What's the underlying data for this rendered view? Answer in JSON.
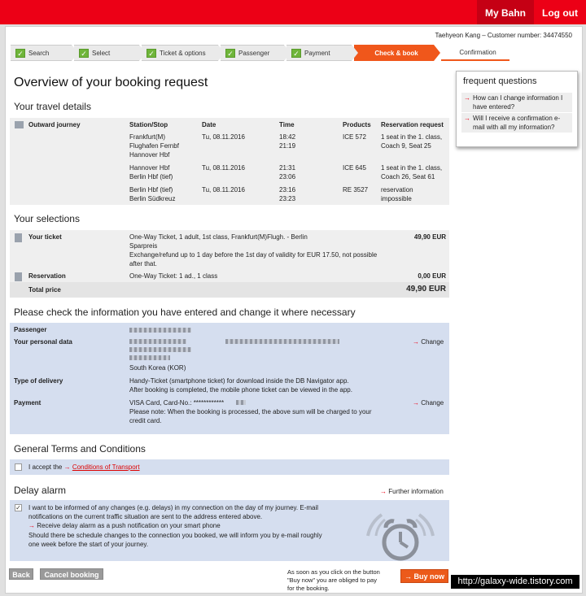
{
  "topnav": {
    "mybahn": "My Bahn",
    "logout": "Log out"
  },
  "customer": "Taehyeon Kang – Customer number: 34474550",
  "steps": [
    {
      "label": "Search"
    },
    {
      "label": "Select"
    },
    {
      "label": "Ticket & options"
    },
    {
      "label": "Passenger"
    },
    {
      "label": "Payment"
    },
    {
      "label": "Check & book"
    },
    {
      "label": "Confirmation"
    }
  ],
  "title": "Overview of your booking request",
  "travel": {
    "heading": "Your travel details",
    "headers": {
      "station": "Station/Stop",
      "date": "Date",
      "time": "Time",
      "products": "Products",
      "reservation": "Reservation request"
    },
    "journey_label": "Outward journey",
    "legs": [
      {
        "station1": "Frankfurt(M)",
        "station2": "Flughafen Fernbf",
        "station3": "Hannover Hbf",
        "date": "Tu, 08.11.2016",
        "time1": "18:42",
        "time2": "21:19",
        "product": "ICE 572",
        "res1": "1 seat in the 1. class,",
        "res2": "Coach 9, Seat 25"
      },
      {
        "station1": "Hannover Hbf",
        "station2": "Berlin Hbf (tief)",
        "date": "Tu, 08.11.2016",
        "time1": "21:31",
        "time2": "23:06",
        "product": "ICE 645",
        "res1": "1 seat in the 1. class,",
        "res2": "Coach 26, Seat 61"
      },
      {
        "station1": "Berlin Hbf (tief)",
        "station2": "Berlin Südkreuz",
        "date": "Tu, 08.11.2016",
        "time1": "23:16",
        "time2": "23:23",
        "product": "RE 3527",
        "res1": "reservation",
        "res2": "impossible"
      }
    ]
  },
  "selections": {
    "heading": "Your selections",
    "ticket_label": "Your ticket",
    "ticket_l1": "One-Way Ticket, 1 adult, 1st class, Frankfurt(M)Flugh. - Berlin",
    "ticket_l2": "Sparpreis",
    "ticket_l3": "Exchange/refund up to 1 day before the 1st day of validity for EUR 17.50, not possible",
    "ticket_l4": "after that.",
    "ticket_price": "49,90 EUR",
    "reservation_label": "Reservation",
    "reservation_desc": "One-Way Ticket: 1 ad., 1 class",
    "reservation_price": "0,00 EUR",
    "total_label": "Total price",
    "total_price": "49,90 EUR"
  },
  "check": {
    "heading": "Please check the information you have entered and change it where necessary",
    "passenger_label": "Passenger",
    "personal_label": "Your personal data",
    "country": "South Korea (KOR)",
    "change": "Change",
    "delivery_label": "Type of delivery",
    "delivery_l1": "Handy-Ticket (smartphone ticket) for download inside the DB Navigator app.",
    "delivery_l2": "After booking is completed, the mobile phone ticket can be viewed in the app.",
    "payment_label": "Payment",
    "payment_l1": "VISA Card, Card-No.: ************",
    "payment_l2": "Please note: When the booking is processed, the above sum will be charged to your",
    "payment_l3": "credit card."
  },
  "terms": {
    "heading": "General Terms and Conditions",
    "accept": "I accept the",
    "link": "Conditions of Transport"
  },
  "delay": {
    "heading": "Delay alarm",
    "further": "Further information",
    "l1": "I want to be informed of any changes (e.g. delays) in my connection on the day of my journey. E-mail",
    "l2": "notifications on the current traffic situation are sent to the address entered above.",
    "l3": "Receive delay alarm as a push notification on your smart phone",
    "l4": "Should there be schedule changes to the connection you booked, we will inform you by e-mail roughly",
    "l5": "one week before the start of your journey."
  },
  "footer": {
    "back": "Back",
    "cancel": "Cancel booking",
    "note1": "As soon as you click on the button",
    "note2": "\"Buy now\" you are obliged to pay",
    "note3": "for the booking.",
    "buy": "Buy now"
  },
  "faq": {
    "title": "frequent questions",
    "q1": "How can I change information I have entered?",
    "q2": "Will I receive a confirmation e-mail with all my information?"
  },
  "watermark": "http://galaxy-wide.tistory.com",
  "colors": {
    "brand": "#ec0016",
    "active_step": "#f0571b",
    "check_green": "#6fb53a",
    "info_blue": "#d5deef"
  }
}
